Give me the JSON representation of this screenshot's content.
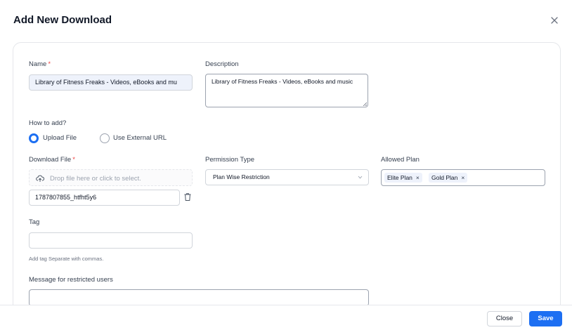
{
  "modal": {
    "title": "Add New Download"
  },
  "form": {
    "name": {
      "label": "Name",
      "required_mark": "*",
      "value": "Library of Fitness Freaks - Videos, eBooks and mu"
    },
    "description": {
      "label": "Description",
      "value": "Library of Fitness Freaks - Videos, eBooks and music"
    },
    "how_to_add": {
      "label": "How to add?",
      "options": [
        {
          "label": "Upload File",
          "selected": true
        },
        {
          "label": "Use External URL",
          "selected": false
        }
      ]
    },
    "download_file": {
      "label": "Download File",
      "required_mark": "*",
      "dropzone_text": "Drop file here or click to select.",
      "file_name": "1787807855_htfht5y6"
    },
    "permission_type": {
      "label": "Permission Type",
      "value": "Plan Wise Restriction"
    },
    "allowed_plan": {
      "label": "Allowed Plan",
      "selected": [
        "Elite Plan",
        "Gold Plan"
      ],
      "remove_glyph": "×"
    },
    "tag": {
      "label": "Tag",
      "value": "",
      "helper": "Add tag Separate with commas."
    },
    "restricted_message": {
      "label": "Message for restricted users",
      "value": ""
    }
  },
  "footer": {
    "close_label": "Close",
    "save_label": "Save"
  },
  "colors": {
    "primary": "#1d6ff2",
    "required": "#ef4444",
    "filled_input_bg": "#eef2fb"
  },
  "icons": [
    "close-icon",
    "cloud-upload-icon",
    "trash-icon",
    "chevron-down-icon"
  ]
}
